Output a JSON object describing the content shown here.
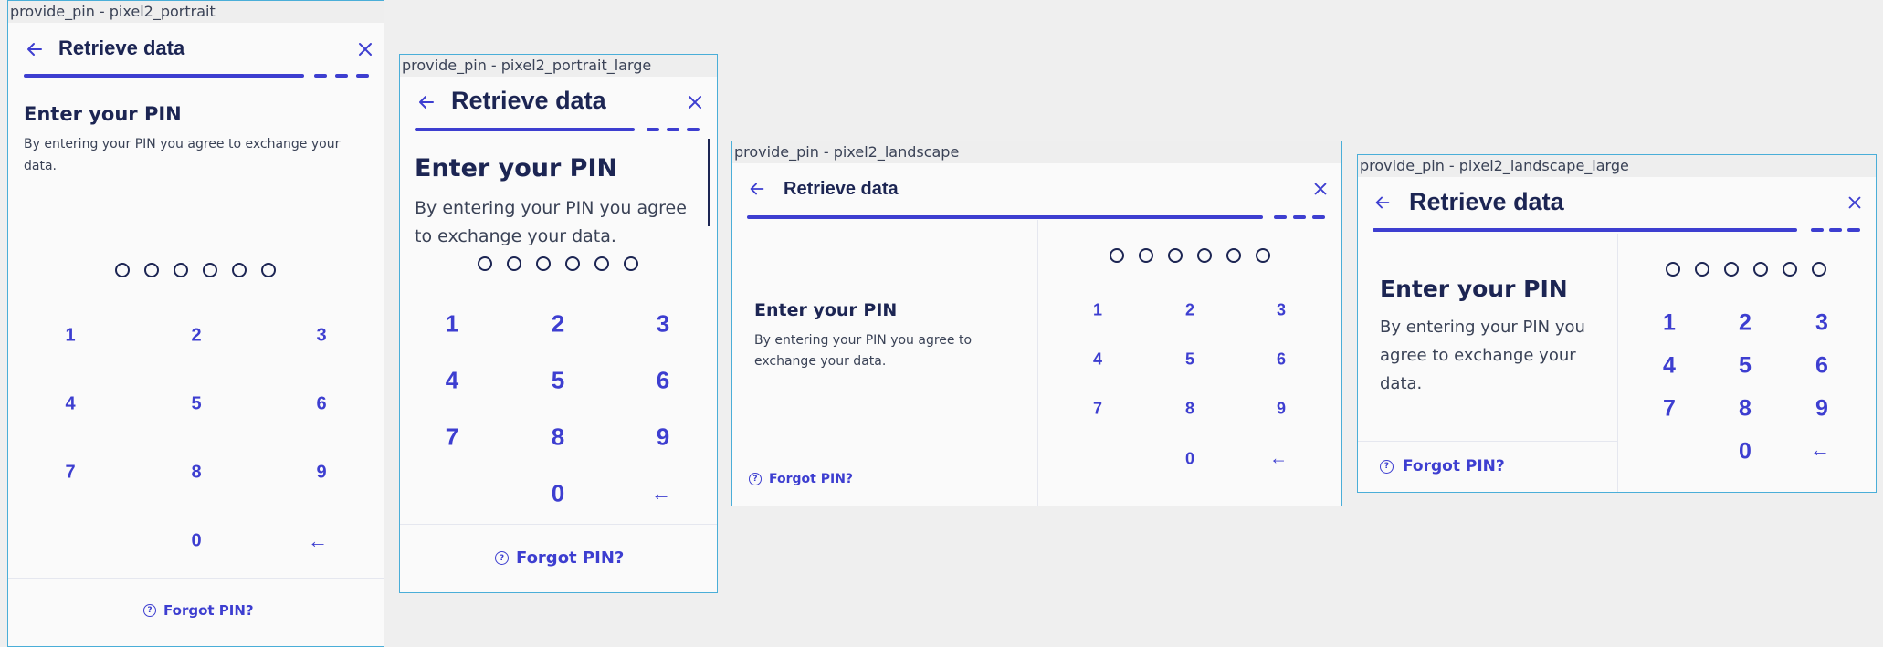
{
  "screens": [
    {
      "caption": "provide_pin - pixel2_portrait",
      "header_title": "Retrieve data",
      "heading": "Enter your PIN",
      "description": "By entering your PIN you agree to exchange your data.",
      "keys": [
        "1",
        "2",
        "3",
        "4",
        "5",
        "6",
        "7",
        "8",
        "9",
        "0"
      ],
      "backspace_glyph": "←",
      "forgot_label": "Forgot PIN?",
      "pin_dot_count": 6
    },
    {
      "caption": "provide_pin - pixel2_portrait_large",
      "header_title": "Retrieve data",
      "heading": "Enter your PIN",
      "description": "By entering your PIN you agree to exchange your data.",
      "keys": [
        "1",
        "2",
        "3",
        "4",
        "5",
        "6",
        "7",
        "8",
        "9",
        "0"
      ],
      "backspace_glyph": "←",
      "forgot_label": "Forgot PIN?",
      "pin_dot_count": 6
    },
    {
      "caption": "provide_pin - pixel2_landscape",
      "header_title": "Retrieve data",
      "heading": "Enter your PIN",
      "description": "By entering your PIN you agree to exchange your data.",
      "keys": [
        "1",
        "2",
        "3",
        "4",
        "5",
        "6",
        "7",
        "8",
        "9",
        "0"
      ],
      "backspace_glyph": "←",
      "forgot_label": "Forgot PIN?",
      "pin_dot_count": 6
    },
    {
      "caption": "provide_pin - pixel2_landscape_large",
      "header_title": "Retrieve data",
      "heading": "Enter your PIN",
      "description": "By entering your PIN you agree to exchange your data.",
      "keys": [
        "1",
        "2",
        "3",
        "4",
        "5",
        "6",
        "7",
        "8",
        "9",
        "0"
      ],
      "backspace_glyph": "←",
      "forgot_label": "Forgot PIN?",
      "pin_dot_count": 6
    }
  ],
  "colors": {
    "accent": "#3d3ed0",
    "text_dark": "#1c2553",
    "frame_border": "#4aaed8",
    "background": "#efefef"
  },
  "icons": {
    "back": "arrow-left-icon",
    "close": "close-icon",
    "help": "question-circle-icon",
    "backspace": "backspace-arrow-icon"
  }
}
